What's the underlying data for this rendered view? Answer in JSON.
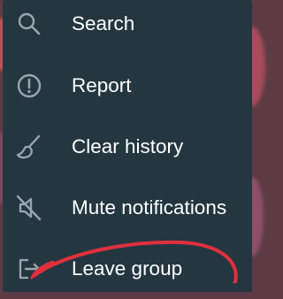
{
  "menu": {
    "items": [
      {
        "label": "Search",
        "icon": "search-icon"
      },
      {
        "label": "Report",
        "icon": "alert-circle-icon"
      },
      {
        "label": "Clear history",
        "icon": "broom-icon"
      },
      {
        "label": "Mute notifications",
        "icon": "speaker-muted-icon"
      },
      {
        "label": "Leave group",
        "icon": "exit-icon"
      }
    ]
  },
  "colors": {
    "menu_background": "#243741",
    "icon_color": "#9aa6ad",
    "label_color": "#ffffff",
    "annotation_stroke": "#e0303c"
  }
}
